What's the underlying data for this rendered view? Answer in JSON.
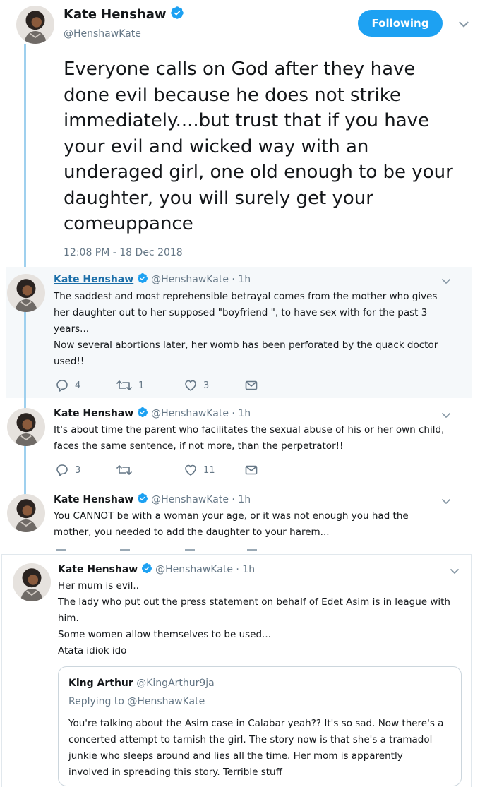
{
  "main_tweet": {
    "name": "Kate Henshaw",
    "handle": "@HenshawKate",
    "follow_label": "Following",
    "text": "Everyone calls on God after they have done evil because he does not strike immediately....but trust that if you have your evil and wicked way with an underaged girl, one old enough to be your daughter, you will surely get your comeuppance",
    "timestamp": "12:08 PM - 18 Dec 2018"
  },
  "replies": [
    {
      "name": "Kate Henshaw",
      "handle": "@HenshawKate",
      "time": "· 1h",
      "lines": [
        "The saddest and most reprehensible betrayal comes from the mother who gives",
        "her daughter out to her supposed \"boyfriend \", to have sex with for the past 3",
        "years...",
        "Now several abortions later, her womb has been perforated by the quack doctor",
        "used!!"
      ],
      "replies_count": "4",
      "retweets_count": "1",
      "likes_count": "3"
    },
    {
      "name": "Kate Henshaw",
      "handle": "@HenshawKate",
      "time": "· 1h",
      "lines": [
        "It's about time the parent who facilitates the sexual abuse of his or her own child,",
        "faces the same sentence, if not more, than the perpetrator!!"
      ],
      "replies_count": "3",
      "retweets_count": "",
      "likes_count": "11"
    },
    {
      "name": "Kate Henshaw",
      "handle": "@HenshawKate",
      "time": "· 1h",
      "lines": [
        "You CANNOT be with a woman your age, or it was not enough you had the",
        "mother, you needed to add the daughter to your harem..."
      ]
    },
    {
      "name": "Kate Henshaw",
      "handle": "@HenshawKate",
      "time": "· 1h",
      "lines": [
        "Her mum is evil..",
        "The lady who put out the press statement on behalf of Edet Asim is in league with",
        "him.",
        "Some women allow themselves to be used...",
        "Atata idiok ido"
      ]
    }
  ],
  "quote": {
    "name": "King Arthur",
    "handle": "@KingArthur9ja",
    "replying_to": "Replying to @HenshawKate",
    "lines": [
      "You're talking about the Asim case in Calabar yeah?? It's so sad. Now there's a",
      "concerted attempt to tarnish the girl. The story now is that she's a tramadol",
      "junkie who sleeps around and lies all the time. Her mom is apparently",
      "involved in spreading this story. Terrible stuff"
    ]
  },
  "colors": {
    "accent": "#1da1f2",
    "thread_line": "#9fd0ee",
    "highlight_bg": "#f5f8fa"
  },
  "icons": [
    "verified-badge-icon",
    "chevron-down-icon",
    "reply-icon",
    "retweet-icon",
    "like-icon",
    "direct-message-icon"
  ]
}
